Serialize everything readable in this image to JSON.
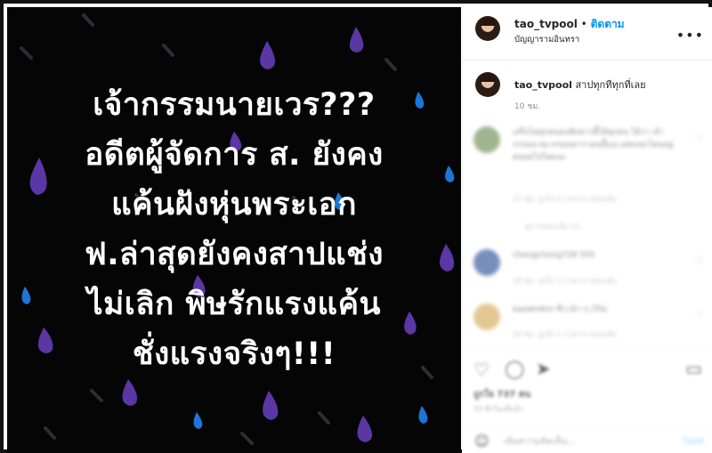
{
  "post": {
    "username": "tao_tvpool",
    "separator": "•",
    "follow_label": "ติดตาม",
    "location": "บัญญารามอินทรา",
    "more_icon": "more-dots-icon",
    "caption": {
      "username": "tao_tvpool",
      "text": "สาปทุกทีทุกที่เลย",
      "time": "10 ชม."
    }
  },
  "media": {
    "lines": [
      "เจ้ากรรมนายเวร???",
      "อดีตผู้จัดการ ส. ยังคง",
      "แค้นฝังหุ่นพระเอก",
      "ฟ.ล่าสุดยังคงสาปแช่ง",
      "ไม่เลิก  พิษรักแรงแค้น",
      "ชั่งแรงจริงๆ!!!"
    ],
    "colors": {
      "background": "#050505",
      "drop_purple": "#5b36a5",
      "drop_blue": "#1e74d8",
      "drop_gray": "#2d2d33"
    }
  },
  "comments": [
    {
      "text": "เสร็จไม่ทุกคนคงฟังข่าวนี้ได้ทุกคน ได้ว่า เจ้ากรรมนายเวรของดาราคนนี้แน่ แต่คงจะโดนอยู่ตลอดไปไหมนะ",
      "meta": "11 ชม.   ถูกใจ 5 รายการ   ตอบกลับ",
      "reply_label": "ดูการตอบกลับ (1)"
    },
    {
      "text": "chongchong728 555",
      "meta": "10 ชม.   ถูกใจ 1 รายการ   ตอบกลับ",
      "reply_label": ""
    },
    {
      "text": "kaewmkm ชีวาน้า ๆ เวิร์ค",
      "meta": "10 ชม.   ถูกใจ 1 รายการ   ตอบกลับ",
      "reply_label": ""
    }
  ],
  "actions": {
    "likes": "ถูกใจ 737 คน",
    "date": "10 ชั่วโมงที่แล้ว",
    "comment_placeholder": "เพิ่มความคิดเห็น...",
    "post_label": "โพสต์"
  }
}
